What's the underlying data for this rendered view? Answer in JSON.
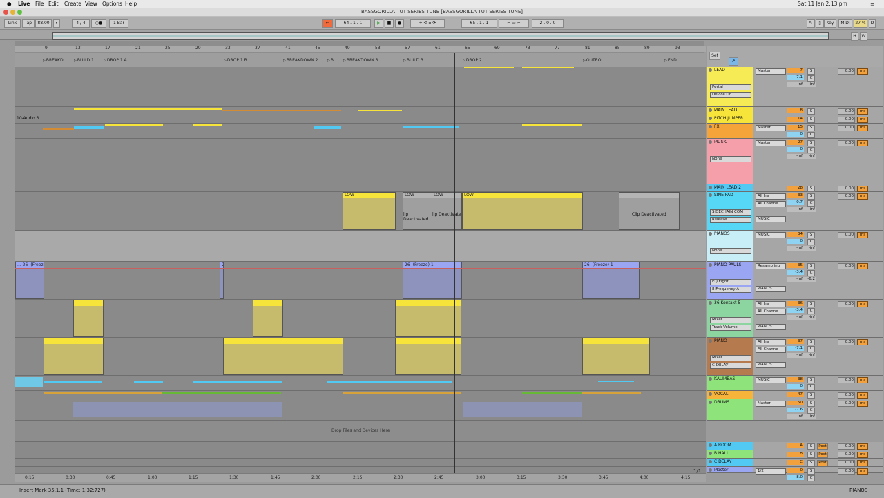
{
  "menubar": {
    "app": "Live",
    "items": [
      "File",
      "Edit",
      "Create",
      "View",
      "Options",
      "Help"
    ],
    "clock": "Sat 11 Jan  2:13 pm"
  },
  "window": {
    "title": "BASSGORILLA TUT SERIES TUNE  [BASSGORILLA TUT SERIES TUNE]"
  },
  "control": {
    "link": "Link",
    "tap": "Tap",
    "tempo": "88.00",
    "signature": "4 / 4",
    "quantize": "1 Bar",
    "position": "64 .  1 .  1",
    "loop_start": "65 .  1 .  1",
    "loop_len": "2 .  0 .  0",
    "key": "Key",
    "midi": "MIDI",
    "cpu": "27 %",
    "d": "D",
    "h": "H",
    "w": "W"
  },
  "bars": [
    "9",
    "13",
    "17",
    "21",
    "25",
    "29",
    "33",
    "37",
    "41",
    "45",
    "49",
    "53",
    "57",
    "61",
    "65",
    "69",
    "73",
    "77",
    "81",
    "85",
    "89",
    "93"
  ],
  "locators": [
    "BREAKD...",
    "BUILD 1",
    "DROP 1 A",
    "DROP 1 B",
    "BREAKDOWN 2",
    "B...",
    "BREAKDOWN 3",
    "BUILD 3",
    "DROP 2",
    "OUTRO",
    "END"
  ],
  "times": [
    "0:15",
    "0:30",
    "0:45",
    "1:00",
    "1:15",
    "1:30",
    "1:45",
    "2:00",
    "2:15",
    "2:30",
    "2:45",
    "3:00",
    "3:15",
    "3:30",
    "3:45",
    "4:00",
    "4:15"
  ],
  "page_indicator": "1/1",
  "clips": {
    "audio_label": "10-Audio 3",
    "low": "LOW",
    "deactivated": "Clip Deactivated",
    "deactivated_a": "lip Deactivated",
    "deactivated_b": "lip Deactivate",
    "freeze_a": "... 26- (Freeze)",
    "freeze_b": "2",
    "freeze": "26- (Freeze) 1",
    "drop_hint": "Drop Files and Devices Here"
  },
  "mixer_set": "Set",
  "tracks": [
    {
      "name": "LEAD",
      "color": "#f6ea55",
      "out": "Master",
      "num": "7",
      "vol": "-7.1",
      "d1": "Portal",
      "d2": "Device On"
    },
    {
      "name": "MAIN LEAD",
      "color": "#f6e43b",
      "num": "8"
    },
    {
      "name": "PITCH JUMPER",
      "color": "#f6e43b",
      "num": "14"
    },
    {
      "name": "FX",
      "color": "#f5a43a",
      "out": "Master",
      "num": "15",
      "vol": "0"
    },
    {
      "name": "MUSIC",
      "color": "#f59fab",
      "out": "Master",
      "num": "27",
      "vol": "0",
      "d1": "None"
    },
    {
      "name": "MAIN LEAD 2",
      "color": "#52c9f2",
      "num": "28"
    },
    {
      "name": "SINE PAD",
      "color": "#55d7f5",
      "out": "All Ins",
      "num": "33",
      "vol": "-0.7",
      "d1": "SIDECHAIN COM",
      "d2": "Release",
      "in": "All Channe",
      "route": "MUSIC"
    },
    {
      "name": "PIANOS",
      "color": "#c8eef7",
      "out": "MUSIC",
      "num": "34",
      "vol": "0",
      "d1": "None"
    },
    {
      "name": "PIANO PAULS",
      "color": "#9aa6f2",
      "out": "Resampling",
      "num": "35",
      "vol": "-3.4",
      "d1": "EQ Eight",
      "d2": "8 Frequency A",
      "val": "-6.2",
      "val2": "-7.5",
      "route": "PIANOS"
    },
    {
      "name": "36 Kontakt 5",
      "color": "#8cd4a0",
      "out": "All Ins",
      "num": "36",
      "vol": "-3.4",
      "d1": "Mixer",
      "d2": "Track Volume",
      "in": "All Channe",
      "route": "PIANOS"
    },
    {
      "name": "PIANO",
      "color": "#b57a4e",
      "out": "All Ins",
      "num": "37",
      "vol": "-7.1",
      "d1": "Mixer",
      "d2": "C-DELAY",
      "in": "All Channe",
      "route": "PIANOS"
    },
    {
      "name": "KALIMBAS",
      "color": "#8ee37a",
      "out": "MUSIC",
      "num": "38",
      "vol": "0"
    },
    {
      "name": "VOCAL",
      "color": "#f6b43a",
      "num": "47"
    },
    {
      "name": "DRUMS",
      "color": "#8ee37a",
      "out": "Master",
      "num": "50",
      "vol": "-7.6"
    },
    {
      "name": "A ROOM",
      "color": "#52c9f2",
      "num": "A"
    },
    {
      "name": "B HALL",
      "color": "#8ee37a",
      "num": "B"
    },
    {
      "name": "C DELAY",
      "color": "#52c9f2",
      "num": "C"
    },
    {
      "name": "Master",
      "color": "#9aa6f2",
      "out": "1/2",
      "num": "0",
      "vol": "-8.0"
    }
  ],
  "mixer_labels": {
    "s": "S",
    "c": "C",
    "inf": "-inf",
    "db": "0.00",
    "ms": "ms",
    "post": "Post",
    "in": "In",
    "auto": "Auto",
    "off": "Off"
  },
  "status": {
    "left": "Insert Mark 35.1.1 (Time: 1:32:727)",
    "right": "PIANOS"
  }
}
